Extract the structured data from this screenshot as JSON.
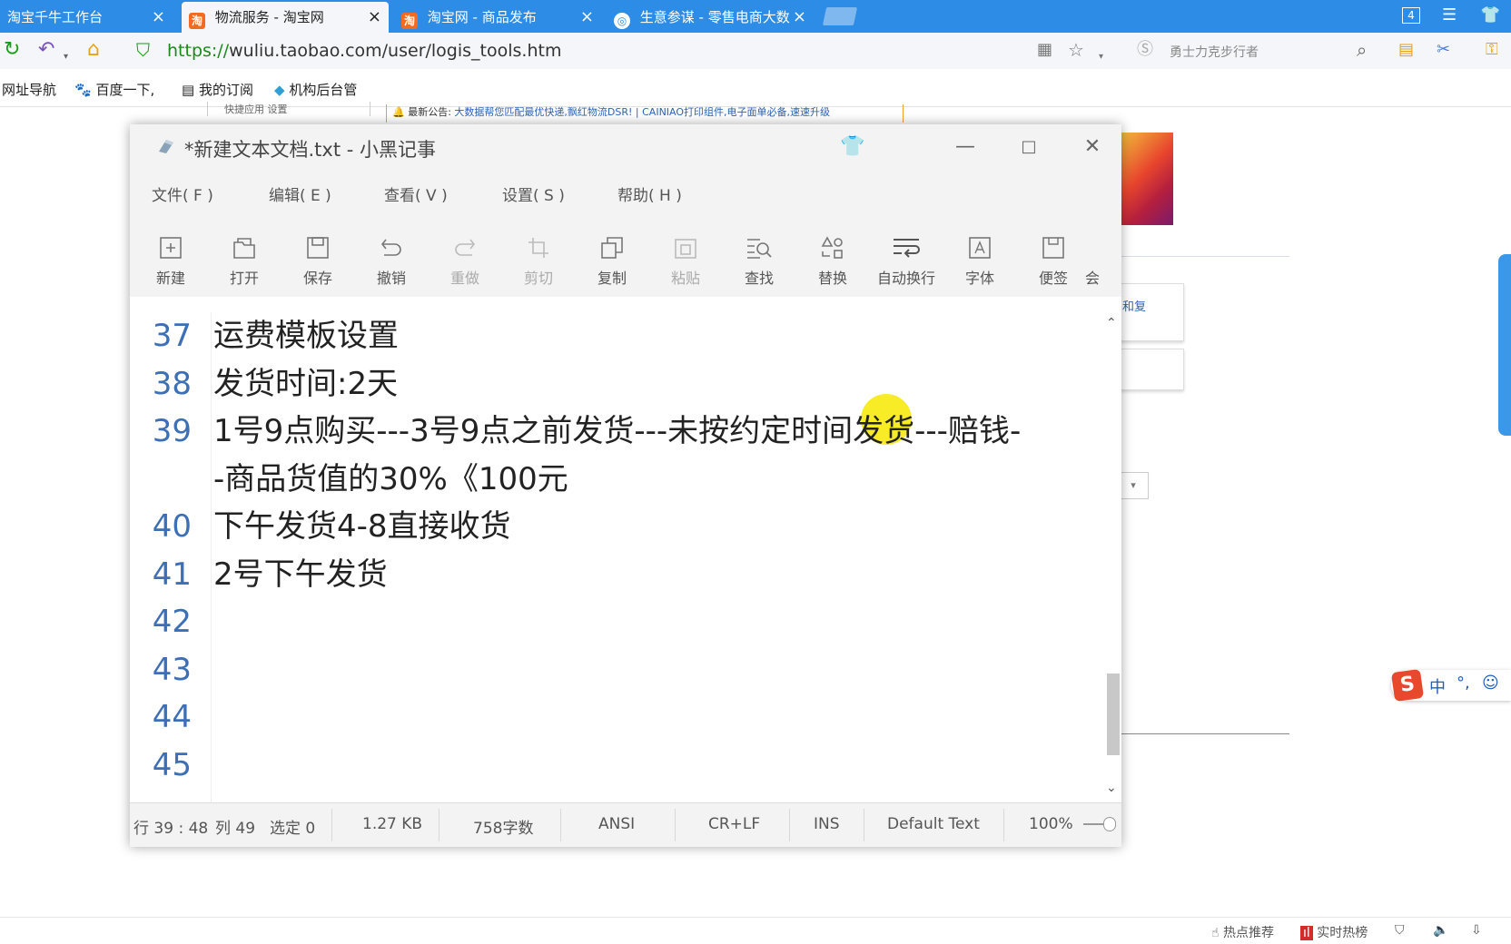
{
  "browser": {
    "tabs": [
      {
        "title": "淘宝千牛工作台"
      },
      {
        "title": "物流服务 - 淘宝网"
      },
      {
        "title": "淘宝网 - 商品发布"
      },
      {
        "title": "生意参谋 - 零售电商大数"
      }
    ],
    "tab_count_badge": "4",
    "url_prefix": "https://",
    "url_rest": "wuliu.taobao.com/user/logis_tools.htm",
    "search_placeholder": "勇士力克步行者",
    "bookmarks": [
      "网址导航",
      "百度一下,",
      "我的订阅",
      "机构后台管"
    ]
  },
  "background_page": {
    "quick_apps": "快捷应用  设置",
    "notice_label": "最新公告:",
    "notice_text": "大数据帮您匹配最优快递,飘红物流DSR! | CAINIAO打印组件,电子面单必备,速速升级",
    "reply_link": "和复"
  },
  "notepad": {
    "title": "*新建文本文档.txt - 小黑记事",
    "menus": [
      "文件( F )",
      "编辑( E )",
      "查看( V )",
      "设置( S )",
      "帮助( H )"
    ],
    "tools": [
      {
        "label": "新建",
        "icon": "new-file-icon",
        "enabled": true
      },
      {
        "label": "打开",
        "icon": "open-folder-icon",
        "enabled": true
      },
      {
        "label": "保存",
        "icon": "save-icon",
        "enabled": true
      },
      {
        "label": "撤销",
        "icon": "undo-icon",
        "enabled": true
      },
      {
        "label": "重做",
        "icon": "redo-icon",
        "enabled": false
      },
      {
        "label": "剪切",
        "icon": "crop-cut-icon",
        "enabled": false
      },
      {
        "label": "复制",
        "icon": "copy-icon",
        "enabled": true
      },
      {
        "label": "粘贴",
        "icon": "paste-icon",
        "enabled": false
      },
      {
        "label": "查找",
        "icon": "find-icon",
        "enabled": true
      },
      {
        "label": "替换",
        "icon": "replace-icon",
        "enabled": true
      },
      {
        "label": "自动换行",
        "icon": "word-wrap-icon",
        "enabled": true
      },
      {
        "label": "字体",
        "icon": "font-icon",
        "enabled": true
      },
      {
        "label": "便签",
        "icon": "sticky-note-icon",
        "enabled": true
      },
      {
        "label": "会",
        "icon": "member-icon",
        "enabled": true
      }
    ],
    "lines": [
      {
        "num": "37",
        "text": "运费模板设置"
      },
      {
        "num": "38",
        "text": "发货时间:2天"
      },
      {
        "num": "39",
        "text": "1号9点购买---3号9点之前发货---未按约定时间发货---赔钱-"
      },
      {
        "num": "",
        "text": "-商品货值的30%《100元"
      },
      {
        "num": "40",
        "text": "下午发货4-8直接收货"
      },
      {
        "num": "41",
        "text": "2号下午发货"
      },
      {
        "num": "42",
        "text": ""
      },
      {
        "num": "43",
        "text": ""
      },
      {
        "num": "44",
        "text": ""
      },
      {
        "num": "45",
        "text": ""
      }
    ],
    "status": {
      "position": "行 39 : 48",
      "column": "列 49",
      "selection": "选定 0",
      "size": "1.27 KB",
      "chars": "758字数",
      "encoding": "ANSI",
      "line_ending": "CR+LF",
      "mode": "INS",
      "syntax": "Default Text",
      "zoom": "100%"
    }
  },
  "ime": {
    "lang": "中",
    "punct": "°,"
  },
  "bottom_bar": {
    "hot_recommend": "热点推荐",
    "realtime_hot": "实时热榜"
  },
  "colors": {
    "browser_blue": "#2d8ce6",
    "line_number": "#3c6fb5",
    "cursor_highlight": "#f6e900"
  }
}
